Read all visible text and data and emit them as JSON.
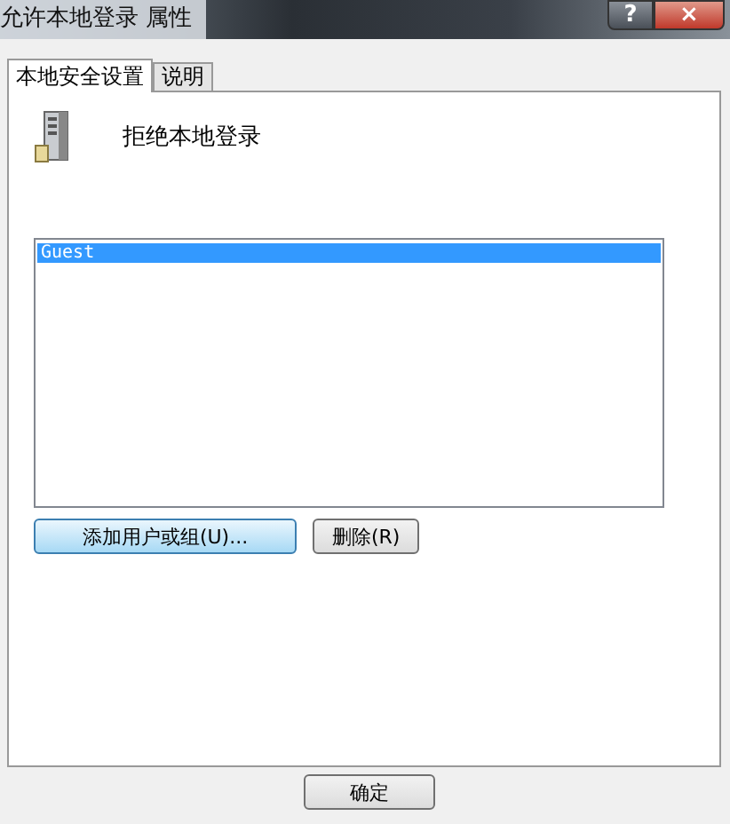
{
  "window": {
    "title": "允许本地登录 属性",
    "caption_buttons": [
      {
        "kind": "help",
        "label": "?"
      },
      {
        "kind": "close",
        "label": "×"
      }
    ]
  },
  "tabs": [
    {
      "label": "本地安全设置",
      "selected": true
    },
    {
      "label": "说明",
      "selected": false
    }
  ],
  "policy": {
    "name": "拒绝本地登录"
  },
  "accounts": [
    {
      "name": "Guest",
      "selected": true
    }
  ],
  "actions": [
    {
      "label": "添加用户或组(U)...",
      "focused": true
    },
    {
      "label": "删除(R)",
      "focused": false
    }
  ],
  "dialog_buttons": [
    "确定"
  ]
}
